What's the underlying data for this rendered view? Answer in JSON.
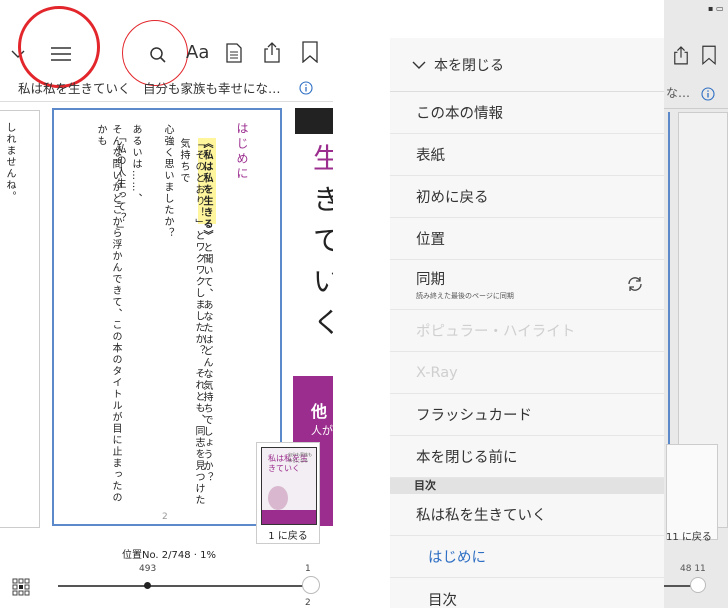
{
  "reader": {
    "book_title": "私は私を生きていく　自分も家族も幸せにな…",
    "left_text": "しれませんね。",
    "page_heading": "はじめに",
    "highlight": "《私は私を生きる》",
    "lines": [
      "と聞いて、あなたはどんな気持ちでしょうか？",
      "「そのとおり！」とワクワクしましたか？　それとも、同志を見つけた気持ちで",
      "心強く思いましたか？",
      "あるいは……、",
      "「私の人生って？」",
      "そんな問いがどこから浮かんできて、この本のタイトルが目に止まったのかも"
    ],
    "page_number": "2",
    "cover_chars": [
      "生",
      "き",
      "て",
      "い",
      "く"
    ],
    "cover_bottom": "他",
    "cover_sub": "人が",
    "mini_cover_title": "私は私を生きていく",
    "mini_cover_sub": "自分も家族も幸せになる",
    "mini_cover_author": "",
    "back_button": "1 に戻る",
    "location": "位置No. 2/748 · 1%",
    "slider_left": "493",
    "slider_right_top": "1",
    "slider_right_bottom": "2",
    "toolbar_aa": "Aa"
  },
  "menu": {
    "close_label": "本を閉じる",
    "items": [
      {
        "label": "この本の情報"
      },
      {
        "label": "表紙"
      },
      {
        "label": "初めに戻る"
      },
      {
        "label": "位置"
      }
    ],
    "sync_label": "同期",
    "sync_sub": "読み終えた最後のページに同期",
    "disabled_items": [
      "ポピュラー・ハイライト",
      "X-Ray"
    ],
    "flashcard": "フラッシュカード",
    "before_close": "本を閉じる前に",
    "toc_header": "目次",
    "toc_items": [
      {
        "label": "私は私を生きていく"
      },
      {
        "label": "はじめに"
      },
      {
        "label": "目次"
      }
    ]
  },
  "background": {
    "title_fragment": "な…",
    "back_button": "11 に戻る",
    "slider_nums": "48 11"
  },
  "colors": {
    "accent_blue": "#2f6fc3",
    "annotation_red": "#e2262b",
    "page_frame": "#5b89c9",
    "highlight_yellow": "#fff59d",
    "cover_purple": "#9b2d8e"
  }
}
